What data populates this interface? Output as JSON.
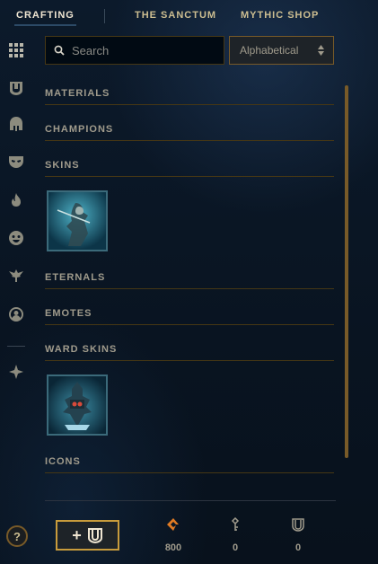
{
  "nav": {
    "tabs": [
      {
        "label": "CRAFTING",
        "active": true
      },
      {
        "label": "THE SANCTUM",
        "active": false
      },
      {
        "label": "MYTHIC SHOP",
        "active": false
      }
    ]
  },
  "rail": {
    "icons": [
      "grid-icon",
      "chest-icon",
      "helmet-icon",
      "mask-icon",
      "flame-icon",
      "emote-face-icon",
      "ward-icon",
      "profile-icon",
      "tft-icon"
    ]
  },
  "search": {
    "placeholder": "Search",
    "value": ""
  },
  "sort": {
    "label": "Alphabetical"
  },
  "sections": [
    {
      "title": "MATERIALS"
    },
    {
      "title": "CHAMPIONS"
    },
    {
      "title": "SKINS"
    },
    {
      "title": "ETERNALS"
    },
    {
      "title": "EMOTES"
    },
    {
      "title": "WARD SKINS"
    },
    {
      "title": "ICONS"
    }
  ],
  "footer": {
    "help_label": "?",
    "add_label": "+",
    "currencies": [
      {
        "name": "orange-essence",
        "value": "800",
        "color": "#e07b24"
      },
      {
        "name": "key",
        "value": "0",
        "color": "#a09b8c"
      },
      {
        "name": "chest",
        "value": "0",
        "color": "#a09b8c"
      }
    ]
  },
  "colors": {
    "gold": "#c89b3c",
    "text": "#a09b8c",
    "highlight": "#f0e6d2"
  }
}
